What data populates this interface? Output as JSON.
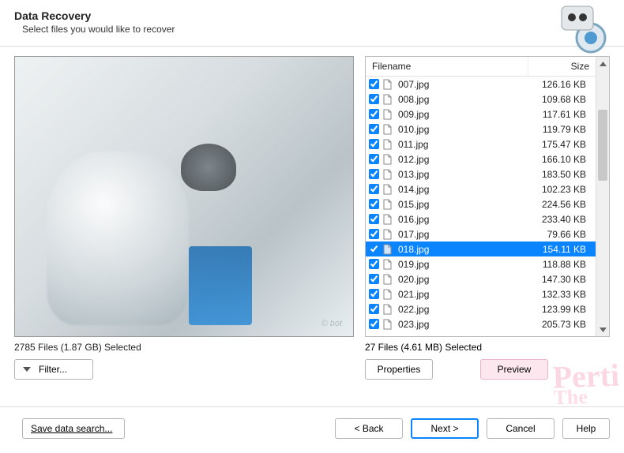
{
  "header": {
    "title": "Data Recovery",
    "subtitle": "Select files you would like to recover"
  },
  "preview": {
    "watermark_text": "© bot"
  },
  "left_panel": {
    "status": "2785 Files (1.87 GB) Selected",
    "filter_label": "Filter..."
  },
  "list": {
    "col_filename": "Filename",
    "col_size": "Size",
    "rows": [
      {
        "name": "007.jpg",
        "size": "126.16 KB",
        "checked": true,
        "selected": false
      },
      {
        "name": "008.jpg",
        "size": "109.68 KB",
        "checked": true,
        "selected": false
      },
      {
        "name": "009.jpg",
        "size": "117.61 KB",
        "checked": true,
        "selected": false
      },
      {
        "name": "010.jpg",
        "size": "119.79 KB",
        "checked": true,
        "selected": false
      },
      {
        "name": "011.jpg",
        "size": "175.47 KB",
        "checked": true,
        "selected": false
      },
      {
        "name": "012.jpg",
        "size": "166.10 KB",
        "checked": true,
        "selected": false
      },
      {
        "name": "013.jpg",
        "size": "183.50 KB",
        "checked": true,
        "selected": false
      },
      {
        "name": "014.jpg",
        "size": "102.23 KB",
        "checked": true,
        "selected": false
      },
      {
        "name": "015.jpg",
        "size": "224.56 KB",
        "checked": true,
        "selected": false
      },
      {
        "name": "016.jpg",
        "size": "233.40 KB",
        "checked": true,
        "selected": false
      },
      {
        "name": "017.jpg",
        "size": "79.66 KB",
        "checked": true,
        "selected": false
      },
      {
        "name": "018.jpg",
        "size": "154.11 KB",
        "checked": true,
        "selected": true
      },
      {
        "name": "019.jpg",
        "size": "118.88 KB",
        "checked": true,
        "selected": false
      },
      {
        "name": "020.jpg",
        "size": "147.30 KB",
        "checked": true,
        "selected": false
      },
      {
        "name": "021.jpg",
        "size": "132.33 KB",
        "checked": true,
        "selected": false
      },
      {
        "name": "022.jpg",
        "size": "123.99 KB",
        "checked": true,
        "selected": false
      },
      {
        "name": "023.jpg",
        "size": "205.73 KB",
        "checked": true,
        "selected": false
      }
    ]
  },
  "right_panel": {
    "status": "27 Files (4.61 MB) Selected",
    "properties_label": "Properties",
    "preview_label": "Preview"
  },
  "footer": {
    "save_search": "Save data search...",
    "back": "< Back",
    "next": "Next >",
    "cancel": "Cancel",
    "help": "Help"
  }
}
